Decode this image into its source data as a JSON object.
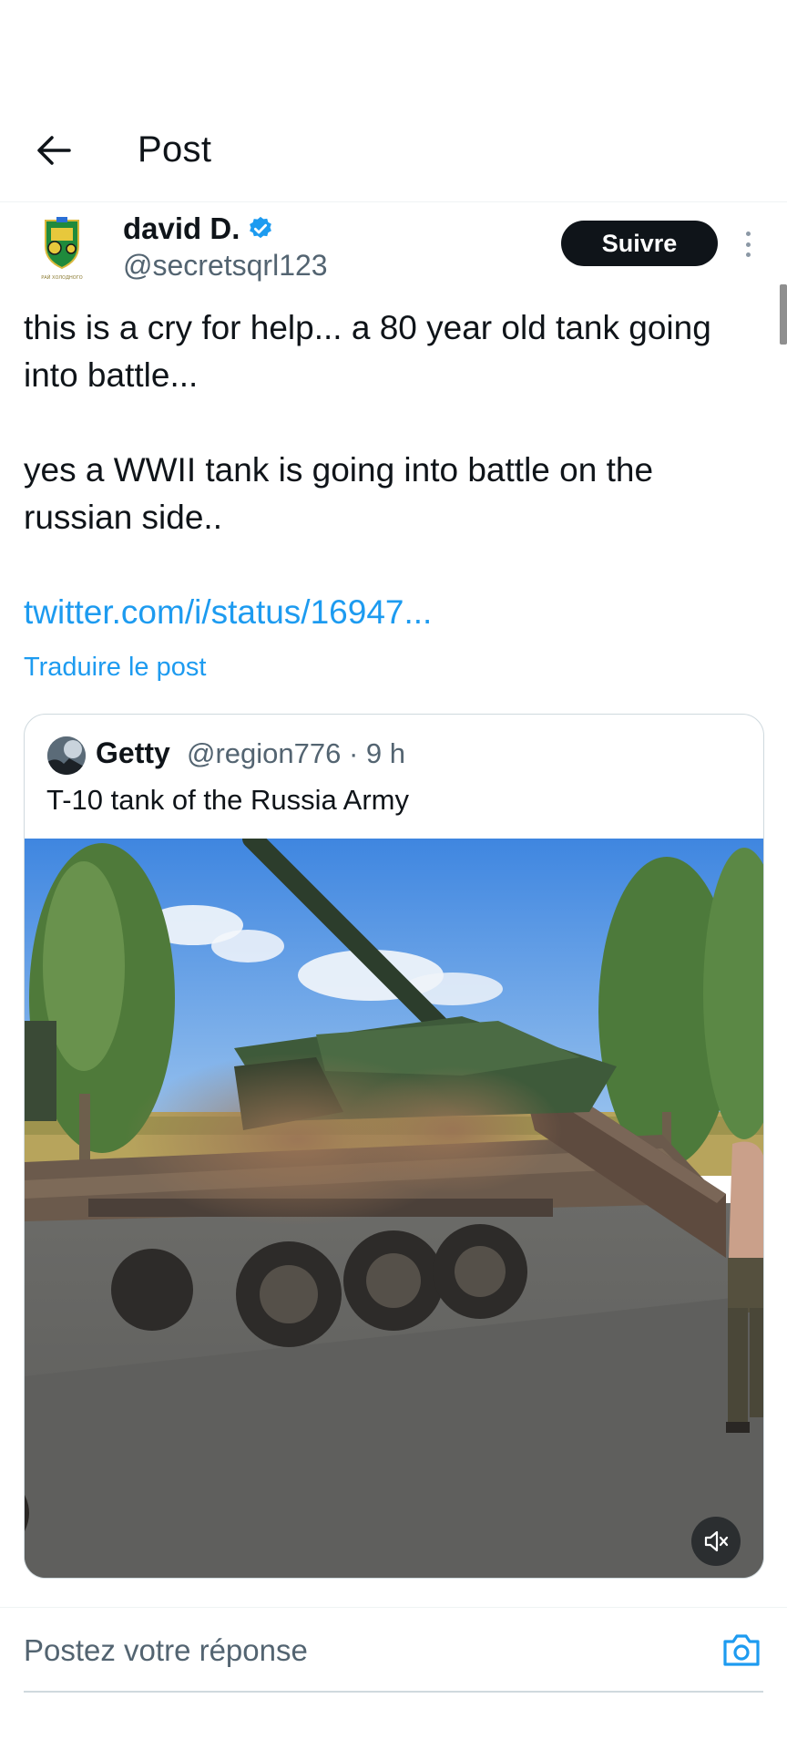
{
  "header": {
    "title": "Post"
  },
  "post": {
    "author": {
      "name": "david D.",
      "handle": "@secretsqrl123",
      "verified": true,
      "avatar_icon": "tractor-emblem-icon",
      "avatar_caption": "РАЙ ХОЛОДНОГО"
    },
    "follow_label": "Suivre",
    "text_paragraphs": [
      "this is a cry for help... a 80 year old tank going into battle...",
      "yes a WWII tank is going into battle on the russian side.."
    ],
    "link": "twitter.com/i/status/16947...",
    "translate_label": "Traduire le post"
  },
  "quote": {
    "name": "Getty",
    "handle_time": "@region776 · 9 h",
    "text": "T-10 tank of the Russia Army",
    "media_icon": "video-tank-on-trailer",
    "mute_icon": "volume-muted-icon"
  },
  "reply": {
    "placeholder": "Postez votre réponse",
    "camera_icon": "camera-icon"
  },
  "colors": {
    "accent": "#1d9bf0",
    "text_primary": "#0f1419",
    "text_secondary": "#536471",
    "border": "#cfd9de"
  }
}
